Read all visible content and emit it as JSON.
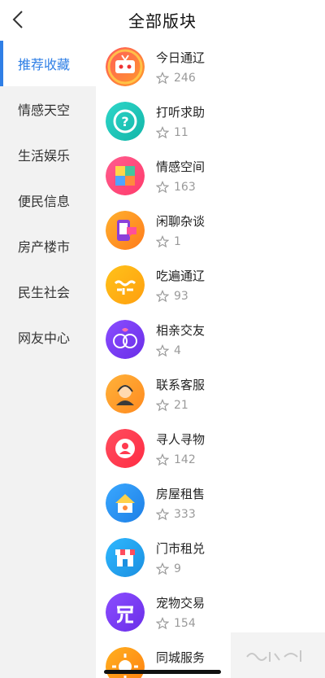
{
  "header": {
    "title": "全部版块"
  },
  "sidebar": {
    "items": [
      {
        "label": "推荐收藏"
      },
      {
        "label": "情感天空"
      },
      {
        "label": "生活娱乐"
      },
      {
        "label": "便民信息"
      },
      {
        "label": "房产楼市"
      },
      {
        "label": "民生社会"
      },
      {
        "label": "网友中心"
      }
    ]
  },
  "forums": [
    {
      "name": "今日通辽",
      "count": "246",
      "icon": "robot-tv-icon"
    },
    {
      "name": "打听求助",
      "count": "11",
      "icon": "question-icon"
    },
    {
      "name": "情感空间",
      "count": "163",
      "icon": "puzzle-icon"
    },
    {
      "name": "闲聊杂谈",
      "count": "1",
      "icon": "chat-phone-icon"
    },
    {
      "name": "吃遍通辽",
      "count": "93",
      "icon": "food-text-icon"
    },
    {
      "name": "相亲交友",
      "count": "4",
      "icon": "couple-faces-icon"
    },
    {
      "name": "联系客服",
      "count": "21",
      "icon": "customer-service-icon"
    },
    {
      "name": "寻人寻物",
      "count": "142",
      "icon": "person-search-icon"
    },
    {
      "name": "房屋租售",
      "count": "333",
      "icon": "house-key-icon"
    },
    {
      "name": "门市租兑",
      "count": "9",
      "icon": "storefront-icon"
    },
    {
      "name": "宠物交易",
      "count": "154",
      "icon": "pet-text-icon"
    },
    {
      "name": "同城服务",
      "count": "",
      "icon": "sun-service-icon"
    }
  ],
  "colors": {
    "accent": "#2f7fe6",
    "sidebar_bg": "#f2f2f2"
  },
  "icons": {
    "back": "chevron-left-icon",
    "star": "star-outline-icon"
  }
}
